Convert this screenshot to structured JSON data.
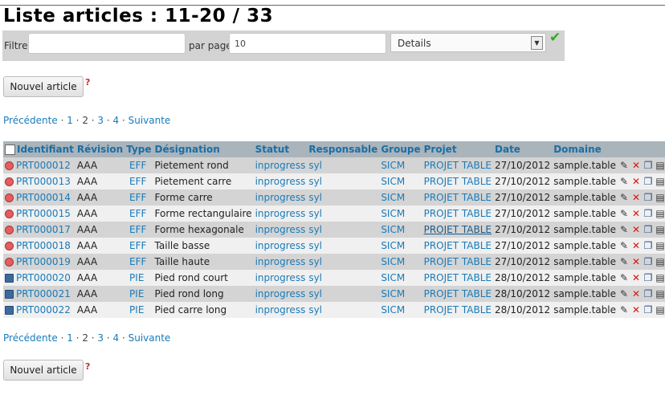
{
  "title": "Liste articles : 11-20 / 33",
  "filter": {
    "label": "Filtre",
    "value": "",
    "per_page_label": "par page",
    "per_page_value": "10",
    "view_select": "Details"
  },
  "new_article_label": "Nouvel article",
  "pager": {
    "prev": "Précédente",
    "pages": [
      "1",
      "2",
      "3",
      "4"
    ],
    "current": "2",
    "next": "Suivante"
  },
  "table": {
    "headers": [
      "Identifiant",
      "Révision",
      "Type",
      "Désignation",
      "Statut",
      "Responsable",
      "Groupe",
      "Projet",
      "Date",
      "Domaine"
    ],
    "rows": [
      {
        "id": "PRT000012",
        "rev": "AAA",
        "type": "EFF",
        "designation": "Pietement rond",
        "statut": "inprogress",
        "resp": "syl",
        "groupe": "SICM",
        "projet": "PROJET TABLE",
        "date": "27/10/2012",
        "domaine": "sample.table",
        "icon": "red-circle-icon"
      },
      {
        "id": "PRT000013",
        "rev": "AAA",
        "type": "EFF",
        "designation": "Pietement carre",
        "statut": "inprogress",
        "resp": "syl",
        "groupe": "SICM",
        "projet": "PROJET TABLE",
        "date": "27/10/2012",
        "domaine": "sample.table",
        "icon": "red-circle-icon"
      },
      {
        "id": "PRT000014",
        "rev": "AAA",
        "type": "EFF",
        "designation": "Forme carre",
        "statut": "inprogress",
        "resp": "syl",
        "groupe": "SICM",
        "projet": "PROJET TABLE",
        "date": "27/10/2012",
        "domaine": "sample.table",
        "icon": "red-circle-icon"
      },
      {
        "id": "PRT000015",
        "rev": "AAA",
        "type": "EFF",
        "designation": "Forme rectangulaire",
        "statut": "inprogress",
        "resp": "syl",
        "groupe": "SICM",
        "projet": "PROJET TABLE",
        "date": "27/10/2012",
        "domaine": "sample.table",
        "icon": "red-circle-icon"
      },
      {
        "id": "PRT000017",
        "rev": "AAA",
        "type": "EFF",
        "designation": "Forme hexagonale",
        "statut": "inprogress",
        "resp": "syl",
        "groupe": "SICM",
        "projet": "PROJET TABLE",
        "date": "27/10/2012",
        "domaine": "sample.table",
        "icon": "red-circle-icon"
      },
      {
        "id": "PRT000018",
        "rev": "AAA",
        "type": "EFF",
        "designation": "Taille basse",
        "statut": "inprogress",
        "resp": "syl",
        "groupe": "SICM",
        "projet": "PROJET TABLE",
        "date": "27/10/2012",
        "domaine": "sample.table",
        "icon": "red-circle-icon"
      },
      {
        "id": "PRT000019",
        "rev": "AAA",
        "type": "EFF",
        "designation": "Taille haute",
        "statut": "inprogress",
        "resp": "syl",
        "groupe": "SICM",
        "projet": "PROJET TABLE",
        "date": "27/10/2012",
        "domaine": "sample.table",
        "icon": "red-circle-icon"
      },
      {
        "id": "PRT000020",
        "rev": "AAA",
        "type": "PIE",
        "designation": "Pied rond court",
        "statut": "inprogress",
        "resp": "syl",
        "groupe": "SICM",
        "projet": "PROJET TABLE",
        "date": "28/10/2012",
        "domaine": "sample.table",
        "icon": "piece-icon"
      },
      {
        "id": "PRT000021",
        "rev": "AAA",
        "type": "PIE",
        "designation": "Pied rond long",
        "statut": "inprogress",
        "resp": "syl",
        "groupe": "SICM",
        "projet": "PROJET TABLE",
        "date": "28/10/2012",
        "domaine": "sample.table",
        "icon": "piece-icon"
      },
      {
        "id": "PRT000022",
        "rev": "AAA",
        "type": "PIE",
        "designation": "Pied carre long",
        "statut": "inprogress",
        "resp": "syl",
        "groupe": "SICM",
        "projet": "PROJET TABLE",
        "date": "28/10/2012",
        "domaine": "sample.table",
        "icon": "piece-icon"
      }
    ]
  },
  "row_actions": [
    "edit-icon",
    "delete-icon",
    "copy-icon",
    "clipboard-icon"
  ],
  "colors": {
    "link": "#1a7bb9",
    "header_bg": "#aab4bb",
    "row_odd": "#d4d4d4",
    "row_even": "#f0f0f0",
    "delete": "#e01010"
  }
}
